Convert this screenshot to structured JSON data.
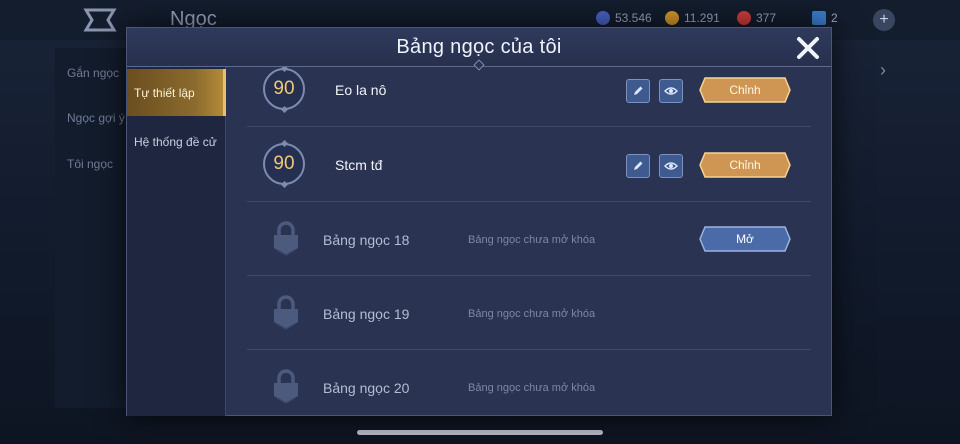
{
  "background": {
    "title": "Ngọc",
    "currencies": [
      {
        "icon": "diamond-icon",
        "value": "53.546",
        "color": "#4a63c9"
      },
      {
        "icon": "gold-coin-icon",
        "value": "11.291",
        "color": "#d99a2b"
      },
      {
        "icon": "ruby-icon",
        "value": "377",
        "color": "#d43d3d"
      },
      {
        "icon": "ticket-icon",
        "value": "2",
        "color": "#3b7fd1"
      }
    ],
    "side_items": [
      "Gắn ngọc",
      "Ngọc gợi ý",
      "Tôi ngọc"
    ]
  },
  "modal": {
    "title": "Bảng ngọc của tôi",
    "close_icon": "close-icon",
    "tabs": [
      {
        "label": "Tự thiết lập",
        "active": true
      },
      {
        "label": "Hệ thống đề cử",
        "active": false
      }
    ],
    "pages": [
      {
        "level": "90",
        "name": "Eo la nô",
        "edit_icon": "pencil-icon",
        "view_icon": "eye-icon",
        "action": "Chỉnh",
        "locked": false
      },
      {
        "level": "90",
        "name": "Stcm tđ",
        "edit_icon": "pencil-icon",
        "view_icon": "eye-icon",
        "action": "Chỉnh",
        "locked": false
      },
      {
        "name": "Bảng ngọc 18",
        "status": "Bảng ngọc chưa mở khóa",
        "action": "Mở",
        "locked": true
      },
      {
        "name": "Bảng ngọc 19",
        "status": "Bảng ngọc chưa mở khóa",
        "locked": true
      },
      {
        "name": "Bảng ngọc 20",
        "status": "Bảng ngọc chưa mở khóa",
        "locked": true
      }
    ]
  },
  "colors": {
    "accent_gold": "#e6b96a",
    "accent_blue": "#4f74b8",
    "modal_bg": "#2a3352"
  }
}
